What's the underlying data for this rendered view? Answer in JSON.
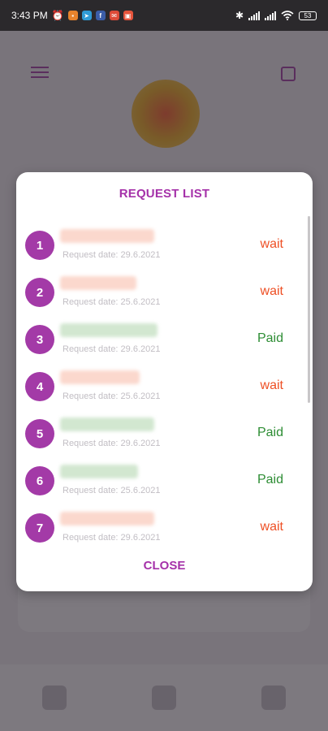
{
  "status_bar": {
    "time": "3:43 PM",
    "battery": "53",
    "icons": [
      "alarm-icon",
      "chat-icon",
      "telegram-icon",
      "facebook-icon",
      "mail-icon",
      "app-icon",
      "bluetooth-icon",
      "signal-icon",
      "wifi-icon",
      "battery-icon"
    ]
  },
  "dialog": {
    "title": "REQUEST LIST",
    "close_label": "CLOSE",
    "items": [
      {
        "number": "1",
        "date": "Request date: 29.6.2021",
        "status": "wait"
      },
      {
        "number": "2",
        "date": "Request date: 25.6.2021",
        "status": "wait"
      },
      {
        "number": "3",
        "date": "Request date: 29.6.2021",
        "status": "Paid"
      },
      {
        "number": "4",
        "date": "Request date: 25.6.2021",
        "status": "wait"
      },
      {
        "number": "5",
        "date": "Request date: 29.6.2021",
        "status": "Paid"
      },
      {
        "number": "6",
        "date": "Request date: 25.6.2021",
        "status": "Paid"
      },
      {
        "number": "7",
        "date": "Request date: 29.6.2021",
        "status": "wait"
      }
    ]
  },
  "colors": {
    "accent": "#a33aa7",
    "wait": "#ee4f24",
    "paid": "#2d8d34"
  }
}
